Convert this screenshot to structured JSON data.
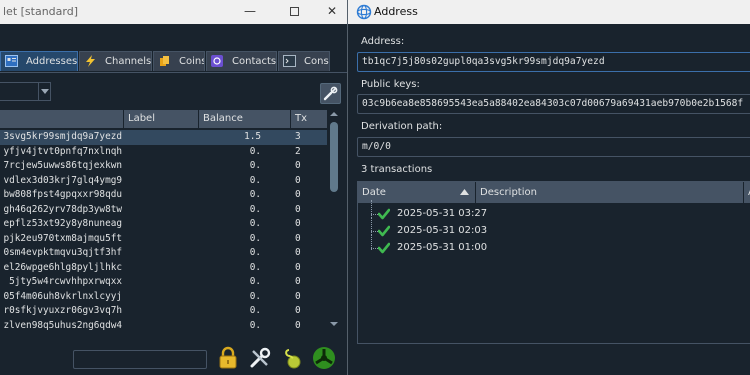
{
  "main_window": {
    "title": "let  [standard]",
    "tabs": [
      {
        "label": "Addresses",
        "icon": "addresses-icon",
        "active": true
      },
      {
        "label": "Channels",
        "icon": "lightning-icon",
        "active": false
      },
      {
        "label": "Coins",
        "icon": "coins-icon",
        "active": false
      },
      {
        "label": "Contacts",
        "icon": "contacts-icon",
        "active": false
      },
      {
        "label": "Cons",
        "icon": "console-icon",
        "active": false
      }
    ],
    "address_table": {
      "columns": [
        "Label",
        "Balance",
        "Tx"
      ],
      "rows": [
        {
          "address": "3svg5kr99smjdq9a7yezd",
          "label": "",
          "balance": "1.5",
          "tx": "3",
          "selected": true
        },
        {
          "address": "yfjv4jtvt0pnfq7nxlnqh",
          "label": "",
          "balance": "0.",
          "tx": "2",
          "selected": false
        },
        {
          "address": "7rcjew5uwws86tqjexkwn",
          "label": "",
          "balance": "0.",
          "tx": "0",
          "selected": false
        },
        {
          "address": "vdlex3d03krj7glq4ymg9",
          "label": "",
          "balance": "0.",
          "tx": "0",
          "selected": false
        },
        {
          "address": "bw808fpst4gpqxxr98qdu",
          "label": "",
          "balance": "0.",
          "tx": "0",
          "selected": false
        },
        {
          "address": "gh46q262yrv78dp3yw8tw",
          "label": "",
          "balance": "0.",
          "tx": "0",
          "selected": false
        },
        {
          "address": "epflz53xt92y8y8nuneag",
          "label": "",
          "balance": "0.",
          "tx": "0",
          "selected": false
        },
        {
          "address": "pjk2eu970txm8ajmqu5ft",
          "label": "",
          "balance": "0.",
          "tx": "0",
          "selected": false
        },
        {
          "address": "0sm4evpktmqvu3qjtf3hf",
          "label": "",
          "balance": "0.",
          "tx": "0",
          "selected": false
        },
        {
          "address": "el26wpge6hlg8pyljlhkc",
          "label": "",
          "balance": "0.",
          "tx": "0",
          "selected": false
        },
        {
          "address": "5jty5w4rcwvhhpxrwqxx",
          "label": "",
          "balance": "0.",
          "tx": "0",
          "selected": false
        },
        {
          "address": "05f4m06uh8vkrlnxlcyyj",
          "label": "",
          "balance": "0.",
          "tx": "0",
          "selected": false
        },
        {
          "address": "r0sfkjvyuxzr06gv3vq7h",
          "label": "",
          "balance": "0.",
          "tx": "0",
          "selected": false
        },
        {
          "address": "zlven98q5uhus2ng6qdw4",
          "label": "",
          "balance": "0.",
          "tx": "0",
          "selected": false
        }
      ]
    },
    "statusbar_icons": [
      "lock-icon",
      "preferences-icon",
      "seed-icon",
      "network-icon"
    ]
  },
  "address_dialog": {
    "title": "Address",
    "address_label": "Address:",
    "address_value": "tb1qc7j5j80s02gupl0qa3svg5kr99smjdq9a7yezd",
    "pubkeys_label": "Public keys:",
    "pubkeys_value": "03c9b6ea8e858695543ea5a88402ea84303c07d00679a69431aeb970b0e2b1568f",
    "derivation_label": "Derivation path:",
    "derivation_value": "m/0/0",
    "tx_count_label": "3 transactions",
    "tx_table": {
      "columns": [
        "Date",
        "Description",
        "A"
      ],
      "rows": [
        {
          "date": "2025-05-31 03:27",
          "status": "confirmed"
        },
        {
          "date": "2025-05-31 02:03",
          "status": "confirmed"
        },
        {
          "date": "2025-05-31 01:00",
          "status": "confirmed"
        }
      ]
    }
  },
  "colors": {
    "background": "#19232d",
    "header": "#455364",
    "selection": "#33495f",
    "accent": "#3b6faa",
    "confirmed_green": "#3fb950"
  }
}
